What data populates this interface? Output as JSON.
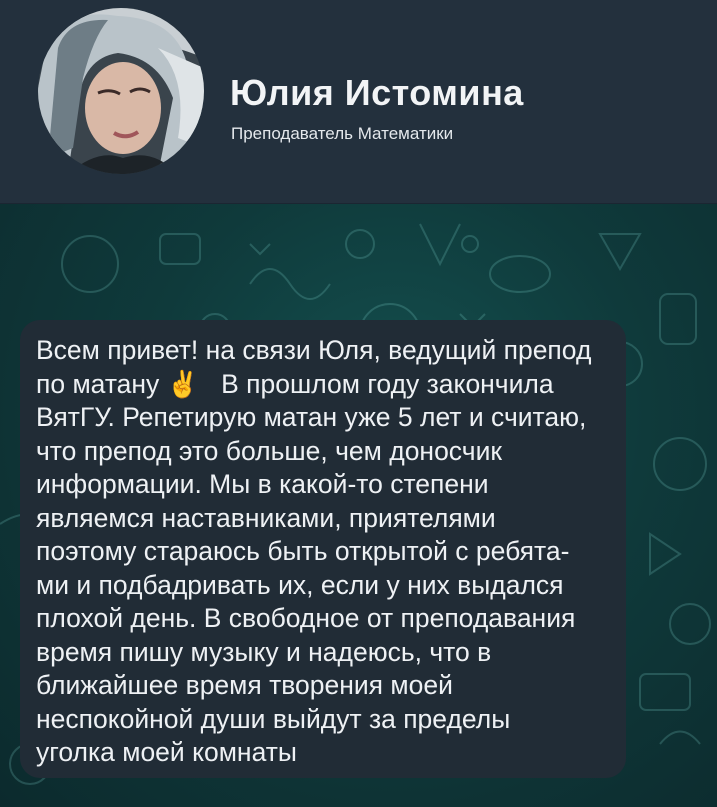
{
  "profile": {
    "name": "Юлия Истомина",
    "role": "Преподаватель Математики"
  },
  "message": {
    "lines": [
      "Всем привет! на связи Юля, ведущий препод",
      "по матану",
      "В прошлом году закончила",
      "ВятГУ. Репетирую матан уже 5 лет и считаю,",
      "что препод это больше, чем доносчик",
      "информации. Мы в какой-то степени",
      "являемся наставниками, приятелями",
      "поэтому стараюсь быть открытой с ребята-",
      "ми и подбадривать их, если у них выдался",
      "плохой день. В свободное от преподавания",
      "время пишу музыку и надеюсь, что в",
      "ближайшее время творения моей",
      "неспокойной души выйдут за пределы",
      "уголка моей комнаты"
    ],
    "emoji": "✌"
  },
  "colors": {
    "header_bg": "#23303d",
    "bubble_bg": "#212c36",
    "chat_bg": "#0f3a3b",
    "text": "#eef1f4"
  }
}
